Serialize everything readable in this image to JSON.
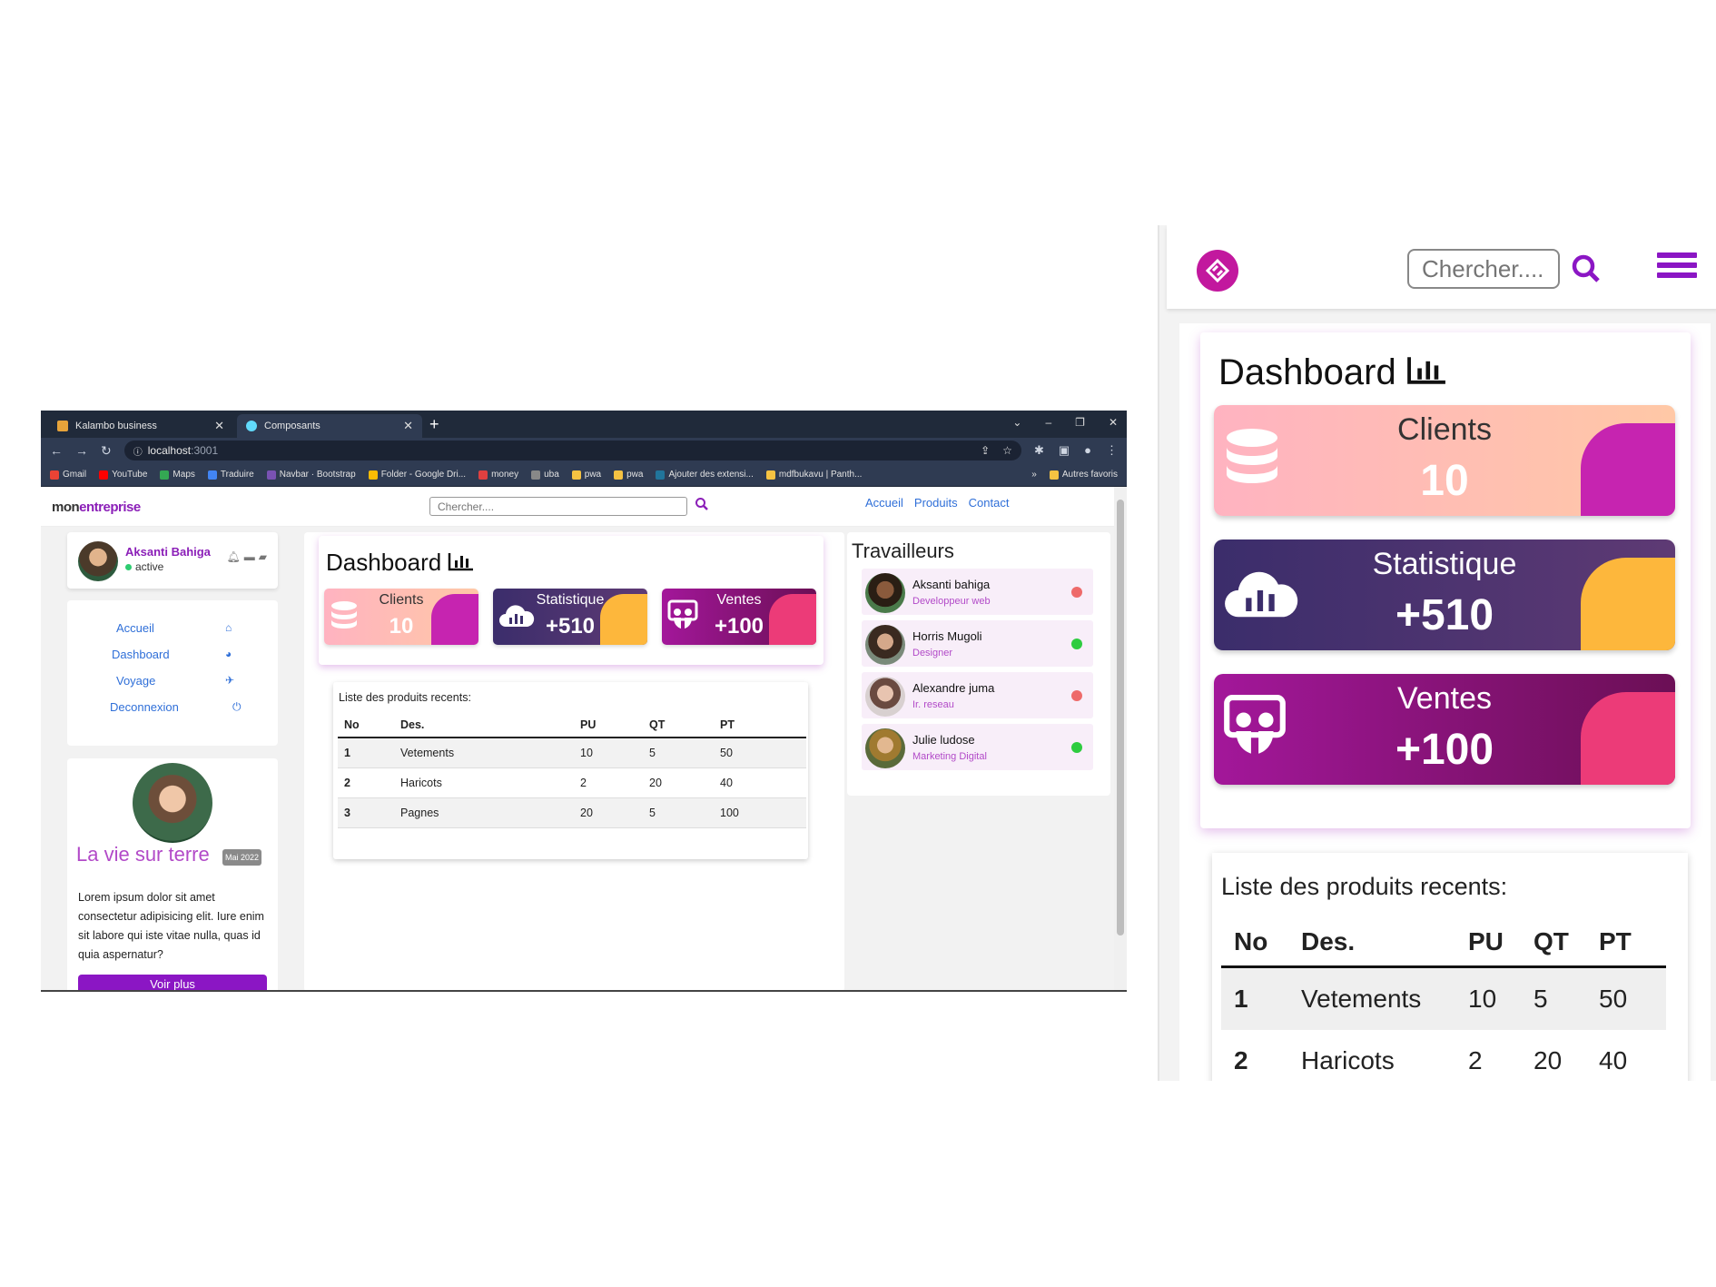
{
  "browser": {
    "tabs": [
      {
        "label": "Kalambo business",
        "favicon_color": "#e6a33a"
      },
      {
        "label": "Composants",
        "favicon_color": "#61dafb"
      }
    ],
    "url_host": "localhost",
    "url_port": ":3001",
    "bookmarks": [
      {
        "label": "Gmail",
        "color": "#ea4335"
      },
      {
        "label": "YouTube",
        "color": "#ff0000"
      },
      {
        "label": "Maps",
        "color": "#34a853"
      },
      {
        "label": "Traduire",
        "color": "#4285f4"
      },
      {
        "label": "Navbar · Bootstrap",
        "color": "#7952b3"
      },
      {
        "label": "Folder - Google Dri...",
        "color": "#fbbc04"
      },
      {
        "label": "money",
        "color": "#e04040"
      },
      {
        "label": "uba",
        "color": "#888888"
      },
      {
        "label": "pwa",
        "color": "#f5c242"
      },
      {
        "label": "pwa",
        "color": "#f5c242"
      },
      {
        "label": "Ajouter des extensi...",
        "color": "#21759b"
      },
      {
        "label": "mdfbukavu | Panth...",
        "color": "#f5c242"
      }
    ],
    "bookmarks_more": "»",
    "other_bookmarks": "Autres favoris"
  },
  "site": {
    "brand_a": "mon",
    "brand_b": "entreprise",
    "search_placeholder": "Chercher....",
    "nav": [
      "Accueil",
      "Produits",
      "Contact"
    ],
    "accent": "#8b1fb8"
  },
  "profile": {
    "name": "Aksanti Bahiga",
    "status": "active"
  },
  "menu": [
    {
      "label": "Accueil",
      "icon": "home-icon"
    },
    {
      "label": "Dashboard",
      "icon": "pie-chart-icon"
    },
    {
      "label": "Voyage",
      "icon": "plane-icon"
    },
    {
      "label": "Deconnexion",
      "icon": "power-icon"
    }
  ],
  "blog": {
    "title": "La vie sur terre",
    "badge": "Mai 2022",
    "text": "Lorem ipsum dolor sit amet consectetur adipisicing elit. Iure enim sit labore qui iste vitae nulla, quas id quia aspernatur?",
    "button": "Voir plus"
  },
  "dashboard": {
    "title": "Dashboard",
    "stats": [
      {
        "label": "Clients",
        "value": "10"
      },
      {
        "label": "Statistique",
        "value": "+510"
      },
      {
        "label": "Ventes",
        "value": "+100"
      }
    ]
  },
  "products": {
    "caption": "Liste des produits recents:",
    "headers": [
      "No",
      "Des.",
      "PU",
      "QT",
      "PT"
    ],
    "rows": [
      [
        "1",
        "Vetements",
        "10",
        "5",
        "50"
      ],
      [
        "2",
        "Haricots",
        "2",
        "20",
        "40"
      ],
      [
        "3",
        "Pagnes",
        "20",
        "5",
        "100"
      ]
    ]
  },
  "workers": {
    "title": "Travailleurs",
    "list": [
      {
        "name": "Aksanti bahiga",
        "role": "Developpeur web",
        "online": false
      },
      {
        "name": "Horris Mugoli",
        "role": "Designer",
        "online": true
      },
      {
        "name": "Alexandre juma",
        "role": "Ir. reseau",
        "online": false
      },
      {
        "name": "Julie ludose",
        "role": "Marketing Digital",
        "online": true
      }
    ]
  },
  "mobile": {
    "search_placeholder": "Chercher....",
    "partial_row": [
      "2",
      "Haricots",
      "2",
      "20",
      "40"
    ]
  }
}
